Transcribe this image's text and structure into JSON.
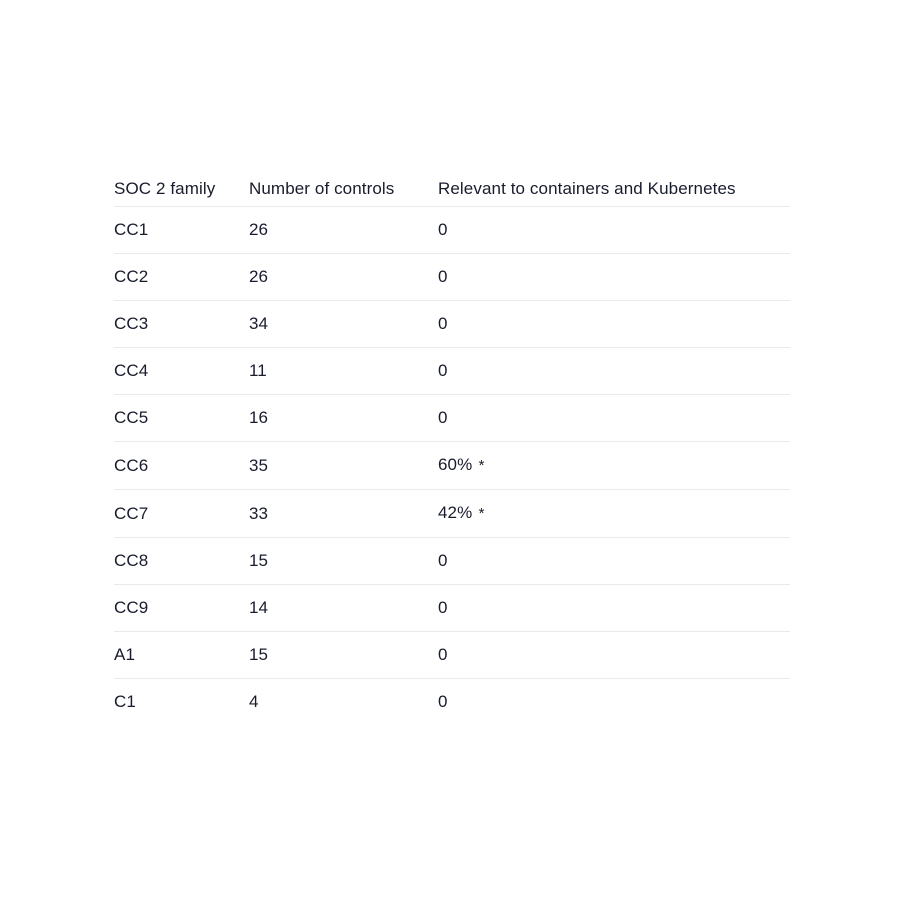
{
  "table": {
    "columns": [
      "SOC 2 family",
      "Number of controls",
      "Relevant to containers and Kubernetes"
    ],
    "rows": [
      {
        "family": "CC1",
        "controls": "26",
        "relevant": "0"
      },
      {
        "family": "CC2",
        "controls": "26",
        "relevant": "0"
      },
      {
        "family": "CC3",
        "controls": "34",
        "relevant": "0"
      },
      {
        "family": "CC4",
        "controls": "11",
        "relevant": "0"
      },
      {
        "family": "CC5",
        "controls": "16",
        "relevant": "0"
      },
      {
        "family": "CC6",
        "controls": "35",
        "relevant": "60% *"
      },
      {
        "family": "CC7",
        "controls": "33",
        "relevant": "42% *"
      },
      {
        "family": "CC8",
        "controls": "15",
        "relevant": "0"
      },
      {
        "family": "CC9",
        "controls": "14",
        "relevant": "0"
      },
      {
        "family": "A1",
        "controls": "15",
        "relevant": "0"
      },
      {
        "family": "C1",
        "controls": "4",
        "relevant": "0"
      }
    ]
  },
  "style": {
    "background": "#ffffff",
    "text_color": "#181c2c",
    "rule_color": "#e9e9ee"
  }
}
